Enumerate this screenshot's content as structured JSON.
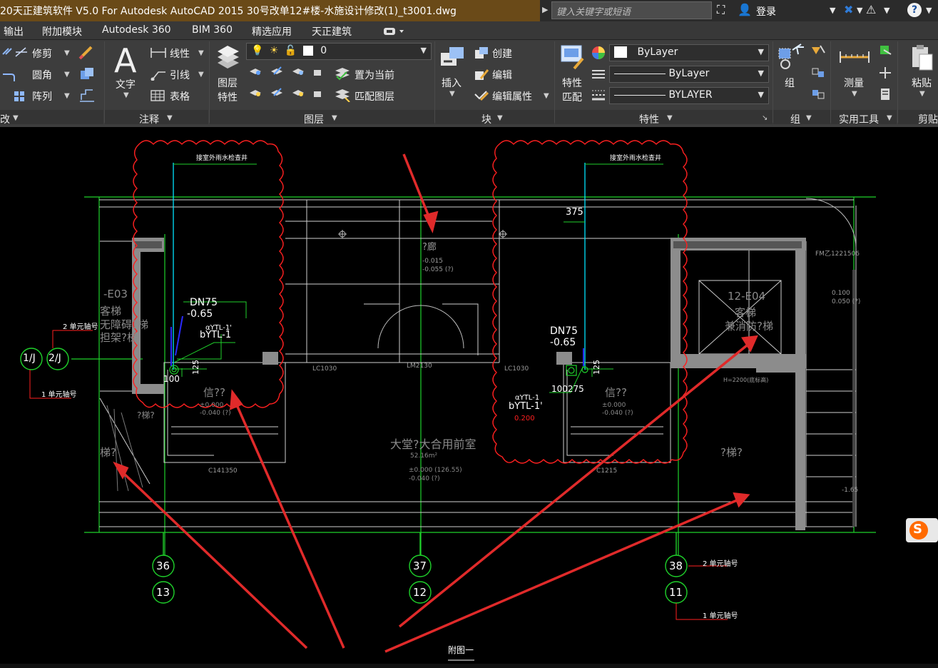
{
  "titlebar": {
    "title": "20天正建筑软件 V5.0 For Autodesk AutoCAD 2015    30号改单12#楼-水施设计修改(1)_t3001.dwg",
    "search_placeholder": "键入关键字或短语",
    "login_label": "登录",
    "help_label": "?"
  },
  "menu": {
    "items": [
      "输出",
      "附加模块",
      "Autodesk 360",
      "BIM 360",
      "精选应用",
      "天正建筑"
    ]
  },
  "ribbon": {
    "modify": {
      "trim_label": "修剪",
      "fillet_label": "圆角",
      "array_label": "阵列",
      "title": "改"
    },
    "annotation": {
      "text_label": "文字",
      "linear_label": "线性",
      "leader_label": "引线",
      "table_label": "表格",
      "title": "注释"
    },
    "layers": {
      "properties_label": "图层\n特性",
      "properties_line1": "图层",
      "properties_line2": "特性",
      "current_layer": "0",
      "set_current_label": "置为当前",
      "match_layer_label": "匹配图层",
      "title": "图层"
    },
    "block": {
      "insert_label": "插入",
      "create_label": "创建",
      "edit_label": "编辑",
      "edit_attr_label": "编辑属性",
      "title": "块"
    },
    "properties": {
      "match_line1": "特性",
      "match_line2": "匹配",
      "color": "ByLayer",
      "linetype": "ByLayer",
      "lineweight": "BYLAYER",
      "title": "特性"
    },
    "group": {
      "group_label": "组",
      "title": "组"
    },
    "utilities": {
      "measure_label": "测量",
      "title": "实用工具"
    },
    "clipboard": {
      "paste_label": "粘贴",
      "title": "剪贴"
    }
  },
  "drawing": {
    "top_left_note": "接室外雨水检查井",
    "top_right_note": "接室外雨水检查井",
    "dim_375": "375",
    "corridor_label": "?廊",
    "corridor_elev1": "-0.015",
    "corridor_elev2": "-0.055 (?)",
    "elev_0100": "0.100",
    "elev_0050": "0.050 (?)",
    "fm_label": "FM乙1221506",
    "lift_left_id": "-E03",
    "lift_left_name": "客梯",
    "lift_left_sub1": "无障碍?梯",
    "lift_left_sub2": "担架?梯",
    "lift_right_id": "12-E04",
    "lift_right_name": "客梯",
    "lift_right_sub": "兼消防?梯",
    "dn75_left": "DN75",
    "dn75_left_elev": "-0.65",
    "ytl_left_a": "αYTL-1'",
    "ytl_left_b": "bYTL-1",
    "dn75_right": "DN75",
    "dn75_right_elev": "-0.65",
    "ytl_right_a": "αYTL-1",
    "ytl_right_b": "bYTL-1'",
    "elev_red": "0.200",
    "dim_100_left": "100",
    "dim_125_left": "125",
    "dim_100275": "100275",
    "dim_125_right": "125",
    "lc1030_left": "LC1030",
    "lm2130": "LM2130",
    "lc1030_right": "LC1030",
    "room_left": "信??",
    "room_left_e1": "±0.000",
    "room_left_e2": "-0.040 (?)",
    "room_right": "信??",
    "room_right_e1": "±0.000",
    "room_right_e2": "-0.040 (?)",
    "window_left": "C141350",
    "window_right": "C1215",
    "hall_name": "大堂?大合用前室",
    "hall_area": "52.16m²",
    "hall_e1": "±0.000 (126.55)",
    "hall_e2": "-0.040 (?)",
    "stair_left": "?梯?",
    "stair_right": "?梯?",
    "stair_left2": "梯?",
    "h2200": "H=2200(底标高)",
    "elev_165": "-1.65",
    "axis_1j": "1/J",
    "axis_2j": "2/J",
    "axis_note_2": "2 单元轴号",
    "axis_note_1": "1 单元轴号",
    "axis_36": "36",
    "axis_13": "13",
    "axis_37": "37",
    "axis_12": "12",
    "axis_38": "38",
    "axis_11": "11",
    "axis_note_right_2": "2 单元轴号",
    "axis_note_right_1": "1 单元轴号",
    "figure_caption": "附图一",
    "sogou_badge": "S"
  },
  "colors": {
    "title_bg": "#6a4a18",
    "cad_green": "#1fd12b",
    "cad_white": "#e8e8e8",
    "cad_red": "#ff2020",
    "cad_cyan": "#00e5ff",
    "arrow_red": "#e02a2a"
  }
}
